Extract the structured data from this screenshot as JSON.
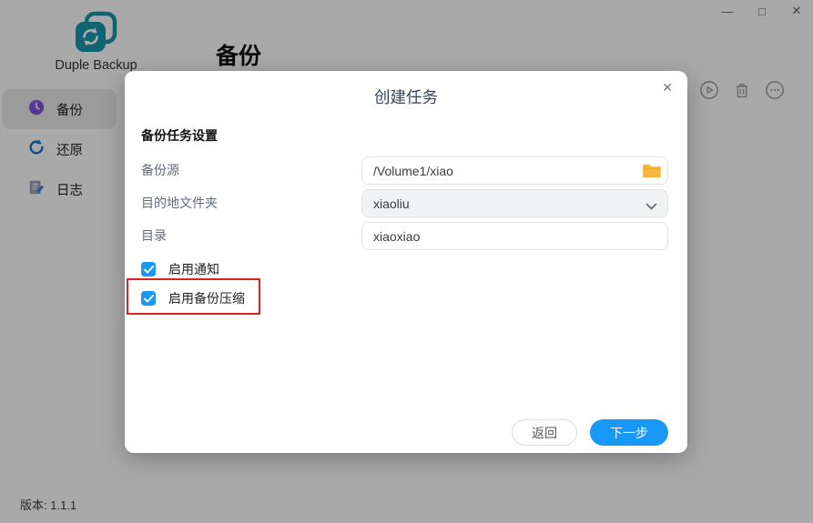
{
  "window": {
    "controls": {
      "minimize": "—",
      "maximize": "□",
      "close": "✕"
    }
  },
  "app": {
    "name": "Duple Backup",
    "logo_icon": "sync-backup-icon",
    "page_title": "备份",
    "version": "版本: 1.1.1"
  },
  "sidebar": {
    "items": [
      {
        "label": "备份",
        "icon": "clock-backup-icon",
        "active": true
      },
      {
        "label": "还原",
        "icon": "restore-arrow-icon",
        "active": false
      },
      {
        "label": "日志",
        "icon": "log-document-icon",
        "active": false
      }
    ]
  },
  "toolbar": {
    "icons": [
      "play-circle-icon",
      "trash-icon",
      "more-circle-icon"
    ]
  },
  "modal": {
    "title": "创建任务",
    "close_glyph": "✕",
    "section_title": "备份任务设置",
    "fields": [
      {
        "label": "备份源",
        "value": "/Volume1/xiao",
        "type": "input-with-folder-button",
        "icon": "folder-icon"
      },
      {
        "label": "目的地文件夹",
        "value": "xiaoliu",
        "type": "select",
        "icon": "chevron-down-icon"
      },
      {
        "label": "目录",
        "value": "xiaoxiao",
        "type": "input"
      }
    ],
    "checkboxes": [
      {
        "label": "启用通知",
        "checked": true
      },
      {
        "label": "启用备份压缩",
        "checked": true,
        "annotated": true
      }
    ],
    "buttons": {
      "back": "返回",
      "next": "下一步"
    }
  },
  "colors": {
    "accent": "#1899f7",
    "logo_teal": "#1895aa",
    "folder_yellow": "#f6b73c",
    "annotation_red": "#e02020",
    "restore_blue": "#1478d2"
  }
}
